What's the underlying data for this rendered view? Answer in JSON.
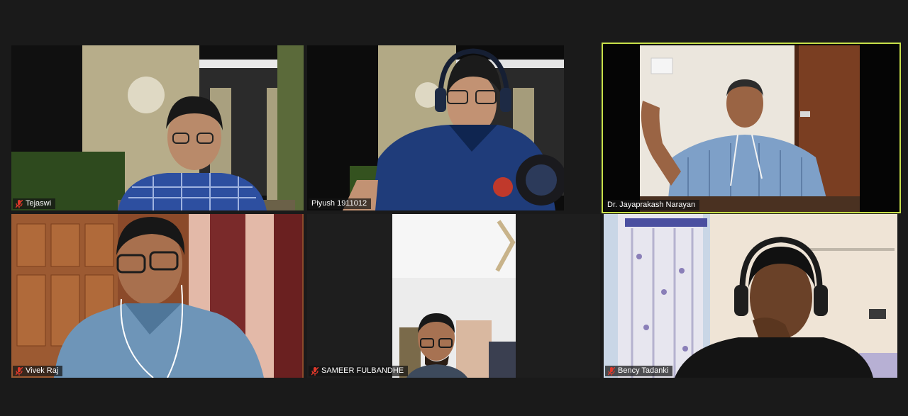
{
  "participants": [
    {
      "name": "Tejaswi",
      "muted": true,
      "active": false
    },
    {
      "name": "Piyush 1911012",
      "muted": false,
      "active": false
    },
    {
      "name": "Dr. Jayaprakash Narayan",
      "muted": false,
      "active": true
    },
    {
      "name": "Vivek Raj",
      "muted": true,
      "active": false
    },
    {
      "name": "SAMEER FULBANDHE",
      "muted": true,
      "active": false
    },
    {
      "name": "Bency Tadanki",
      "muted": true,
      "active": false
    }
  ],
  "colors": {
    "background": "#1a1a1a",
    "active_speaker_border": "#c8e04a",
    "muted_mic": "#e0392b"
  },
  "icons": [
    "mic-muted-icon"
  ]
}
